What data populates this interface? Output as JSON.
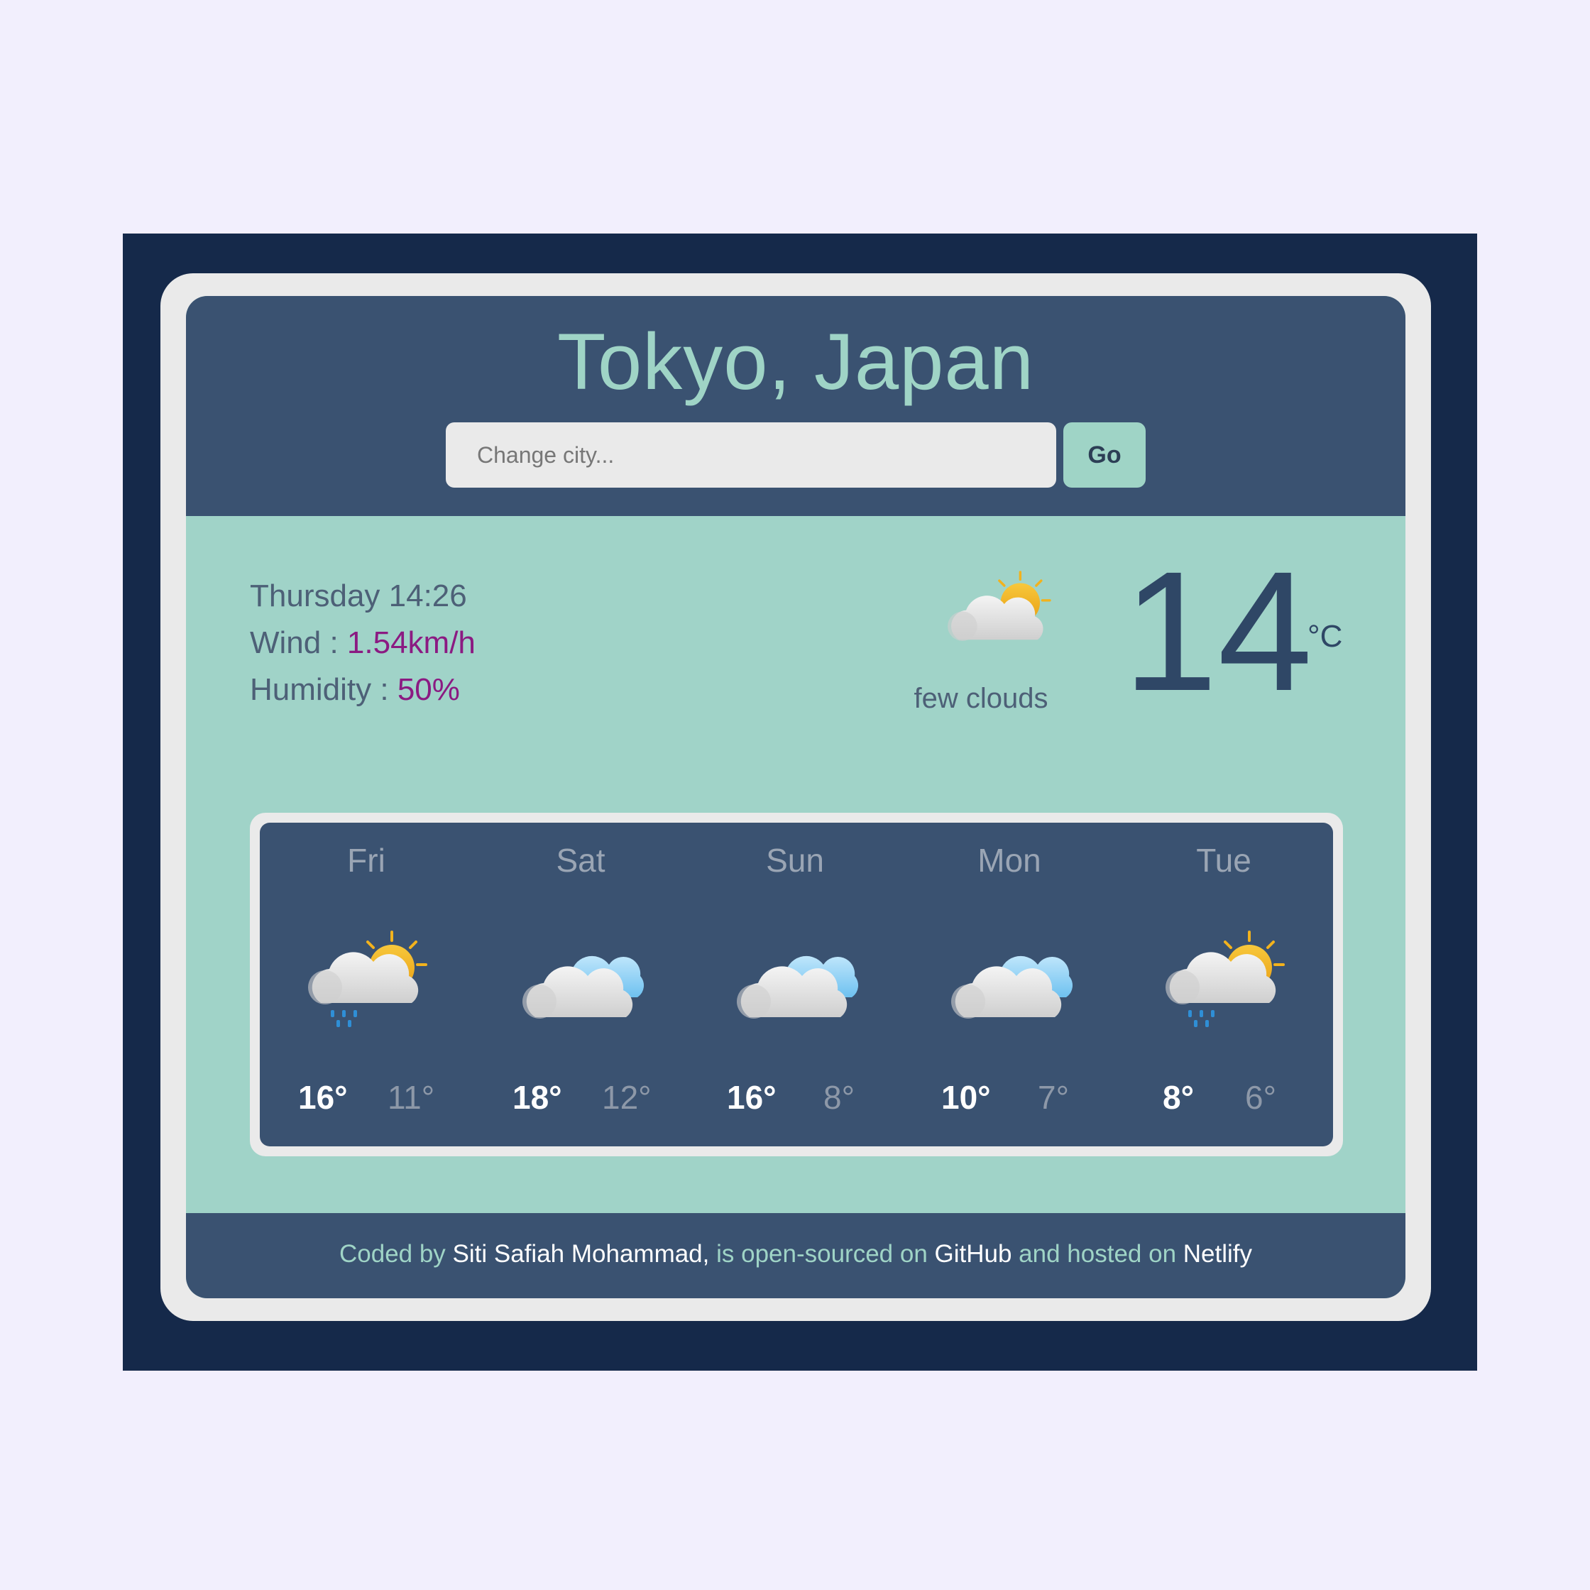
{
  "header": {
    "city": "Tokyo, Japan",
    "search_placeholder": "Change city...",
    "go_label": "Go"
  },
  "current": {
    "datetime": "Thursday 14:26",
    "wind_label": "Wind : ",
    "wind_value": "1.54km/h",
    "humidity_label": "Humidity : ",
    "humidity_value": "50%",
    "description": "few clouds",
    "icon": "partly-cloudy-icon",
    "temperature": "14",
    "unit": "°C"
  },
  "forecast": [
    {
      "day": "Fri",
      "high": "16°",
      "low": "11°",
      "icon": "sun-cloud-rain-icon"
    },
    {
      "day": "Sat",
      "high": "18°",
      "low": "12°",
      "icon": "cloudy-icon"
    },
    {
      "day": "Sun",
      "high": "16°",
      "low": "8°",
      "icon": "cloudy-icon"
    },
    {
      "day": "Mon",
      "high": "10°",
      "low": "7°",
      "icon": "cloudy-icon"
    },
    {
      "day": "Tue",
      "high": "8°",
      "low": "6°",
      "icon": "sun-cloud-rain-icon"
    }
  ],
  "footer": {
    "prefix": "Coded by ",
    "author": "Siti Safiah Mohammad,",
    "middle1": " is open-sourced on ",
    "github": "GitHub",
    "middle2": " and hosted on ",
    "netlify": "Netlify"
  },
  "colors": {
    "page_bg": "#f2effd",
    "outer_bg": "#15294a",
    "panel_dark": "#3a5271",
    "panel_light": "#a0d3c8",
    "accent_mint": "#9fd4c6",
    "value_purple": "#8b1a82"
  }
}
